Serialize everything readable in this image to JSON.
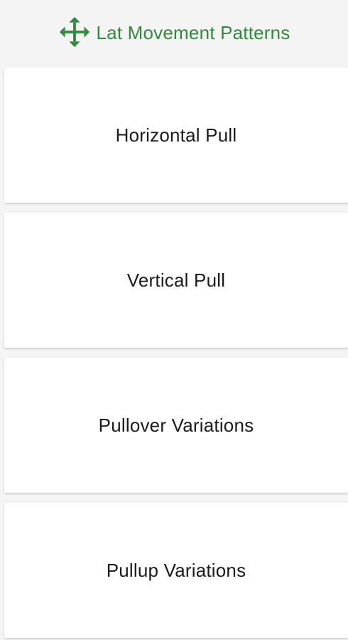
{
  "header": {
    "title": "Lat Movement Patterns",
    "icon": "move-arrows-icon",
    "accent_color": "#2f8a3a"
  },
  "items": [
    {
      "label": "Horizontal Pull"
    },
    {
      "label": "Vertical Pull"
    },
    {
      "label": "Pullover Variations"
    },
    {
      "label": "Pullup Variations"
    }
  ]
}
